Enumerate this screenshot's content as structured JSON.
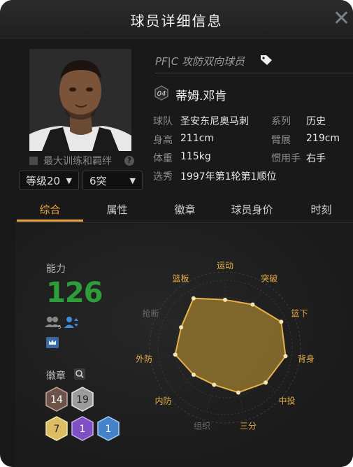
{
  "title": "球员详细信息",
  "close_glyph": "✕",
  "player": {
    "position_text": "PF|C 攻防双向球员",
    "number": "04",
    "name": "蒂姆.邓肯",
    "training_label": "最大训练和羁绊",
    "level": "等级20",
    "breakthrough": "6突",
    "info": {
      "team_label": "球队",
      "team": "圣安东尼奥马刺",
      "series_label": "系列",
      "series": "历史",
      "height_label": "身高",
      "height": "211cm",
      "wingspan_label": "臂展",
      "wingspan": "219cm",
      "weight_label": "体重",
      "weight": "115kg",
      "hand_label": "惯用手",
      "hand": "右手",
      "draft_label": "选秀",
      "draft": "1997年第1轮第1顺位"
    }
  },
  "tabs": [
    "综合",
    "属性",
    "徽章",
    "球员身价",
    "时刻"
  ],
  "active_tab": 0,
  "ability": {
    "label": "能力",
    "value": "126",
    "sub_badge": "5"
  },
  "badges": {
    "label": "徽章",
    "counts": [
      {
        "value": "14",
        "color": "#7a6258"
      },
      {
        "value": "19",
        "color": "#a9a9a9"
      },
      {
        "value": "7",
        "color": "#e1c46c"
      },
      {
        "value": "1",
        "color": "#8b5cc9"
      },
      {
        "value": "1",
        "color": "#4c8fd6"
      }
    ]
  },
  "radar": {
    "axes": [
      "运动",
      "突破",
      "篮下",
      "背身",
      "中投",
      "三分",
      "组织",
      "内防",
      "外防",
      "抢断",
      "篮板"
    ],
    "highlighted": [
      true,
      true,
      true,
      true,
      true,
      true,
      false,
      true,
      true,
      false,
      true
    ],
    "values": [
      0.71,
      0.76,
      0.92,
      0.91,
      0.8,
      0.7,
      0.58,
      0.62,
      0.75,
      0.72,
      0.87
    ],
    "accent": "#e7b04a"
  }
}
